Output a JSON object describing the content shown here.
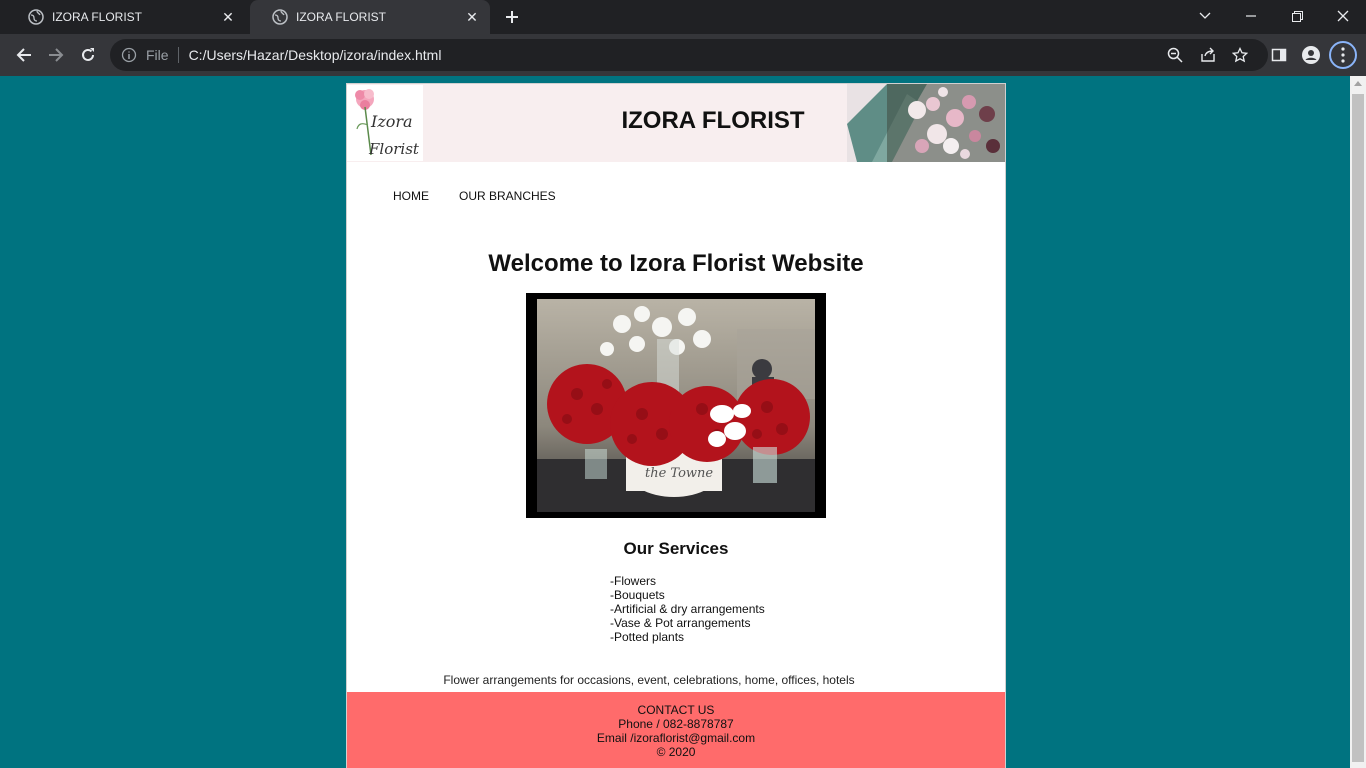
{
  "browser": {
    "tabs": [
      {
        "title": "IZORA FLORIST",
        "active": false
      },
      {
        "title": "IZORA FLORIST",
        "active": true
      }
    ],
    "address": {
      "scheme_label": "File",
      "url": "C:/Users/Hazar/Desktop/izora/index.html"
    }
  },
  "site": {
    "logo_line1": "Izora",
    "logo_line2": "Florist",
    "title": "IZORA FLORIST",
    "nav": [
      {
        "label": "HOME"
      },
      {
        "label": "OUR BRANCHES"
      }
    ],
    "welcome": "Welcome to Izora Florist Website",
    "services_heading": "Our Services",
    "services": [
      "-Flowers",
      "-Bouquets",
      "-Artificial & dry arrangements",
      "-Vase & Pot arrangements",
      "-Potted plants"
    ],
    "tagline": "Flower arrangements for occasions, event, celebrations, home, offices, hotels",
    "footer": {
      "contact": "CONTACT US",
      "phone": "Phone / 082-8878787",
      "email": "Email /izoraflorist@gmail.com",
      "copyright": "© 2020"
    }
  },
  "colors": {
    "page_background": "#007380",
    "header_background": "#f8eeef",
    "footer_background": "#ff6b6b"
  }
}
